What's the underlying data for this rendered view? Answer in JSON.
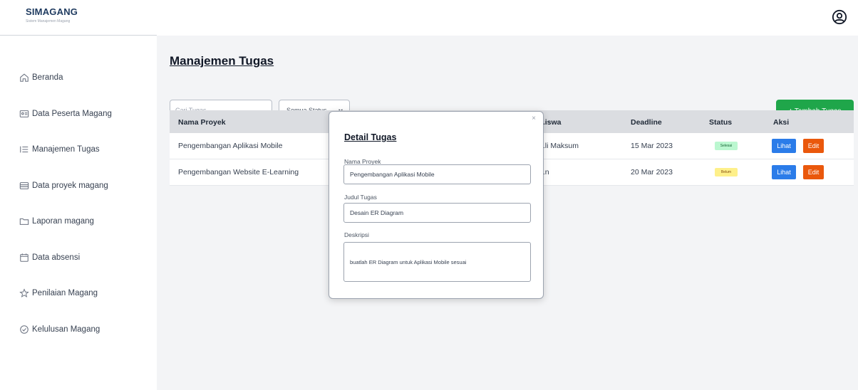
{
  "app": {
    "logo_text": "SIMAGANG",
    "logo_tagline": "Sistem Manajemen Magang"
  },
  "sidebar": {
    "items": [
      {
        "label": "Beranda",
        "icon": "home-icon"
      },
      {
        "label": "Data Peserta Magang",
        "icon": "id-card-icon"
      },
      {
        "label": "Manajemen Tugas",
        "icon": "list-icon"
      },
      {
        "label": "Data proyek magang",
        "icon": "database-icon"
      },
      {
        "label": "Laporan magang",
        "icon": "folder-icon"
      },
      {
        "label": "Data absensi",
        "icon": "calendar-icon"
      },
      {
        "label": "Penilaian Magang",
        "icon": "star-icon"
      },
      {
        "label": "Kelulusan Magang",
        "icon": "check-circle-icon"
      }
    ]
  },
  "header": {
    "profile_icon": "user-circle-icon"
  },
  "page": {
    "title": "Manajemen Tugas"
  },
  "toolbar": {
    "search_placeholder": "Cari Tugas...",
    "status_filter_value": "Semua Status",
    "add_button_label": "+ Tambah Tugas"
  },
  "table": {
    "columns": [
      "Nama Proyek",
      "...iswa",
      "Deadline",
      "Status",
      "Aksi"
    ],
    "rows": [
      {
        "project": "Pengembangan Aplikasi Mobile",
        "student": "...li Maksum",
        "deadline": "15 Mar 2023",
        "status": "Selesai",
        "view_label": "Lihat",
        "edit_label": "Edit"
      },
      {
        "project": "Pengembangan Website E-Learning",
        "student": "...n",
        "deadline": "20 Mar 2023",
        "status": "Belum",
        "view_label": "Lihat",
        "edit_label": "Edit"
      }
    ]
  },
  "modal": {
    "title": "Detail Tugas",
    "close_label": "×",
    "fields": [
      {
        "label": "Nama Proyek",
        "value": "Pengembangan Aplikasi Mobile"
      },
      {
        "label": "Judul Tugas",
        "value": "Desain ER Diagram"
      },
      {
        "label": "Deskripsi",
        "value": "buatlah ER Diagram untuk Aplikasi Mobile sesuai"
      }
    ]
  },
  "colors": {
    "accent_green": "#1fa64a",
    "view_blue": "#2b7ce9",
    "edit_orange": "#ea580c",
    "badge_done": "#bbf7d0",
    "badge_pending": "#fef08a"
  }
}
